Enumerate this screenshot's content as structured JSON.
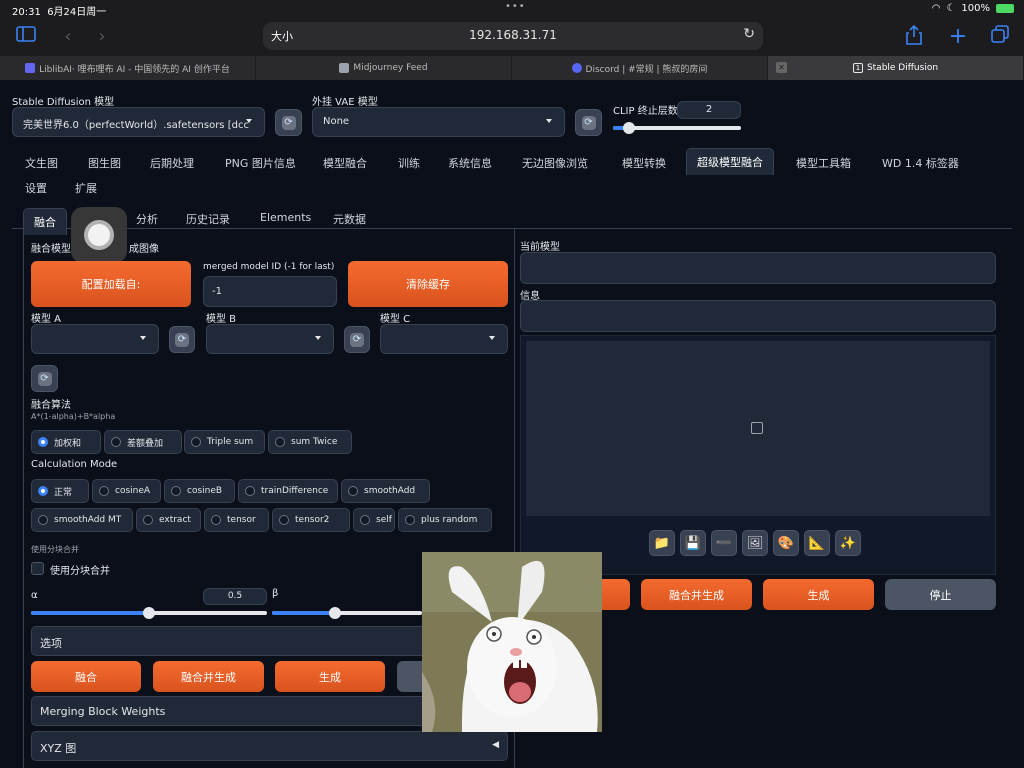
{
  "status": {
    "time": "20:31",
    "date": "6月24日周一",
    "battery": "100%"
  },
  "browser": {
    "text_size": "大小",
    "url": "192.168.31.71",
    "tabs": [
      {
        "label": "LiblibAI· 哩布哩布 AI - 中国领先的 AI 创作平台",
        "icon_color": "#6366f1"
      },
      {
        "label": "Midjourney Feed",
        "icon_color": "#9ca3af"
      },
      {
        "label": "Discord | #常规 | 熊叔的房间",
        "icon_color": "#5865f2"
      },
      {
        "label": "Stable Diffusion",
        "icon_color": "#e5e7eb"
      }
    ]
  },
  "top": {
    "sd_model_label": "Stable Diffusion 模型",
    "sd_model_value": "完美世界6.0（perfectWorld）.safetensors [dcc",
    "vae_label": "外挂 VAE 模型",
    "vae_value": "None",
    "clip_label": "CLIP 终止层数",
    "clip_value": "2",
    "clip_fraction": 0.0833
  },
  "main_tabs": [
    "文生图",
    "图生图",
    "后期处理",
    "PNG 图片信息",
    "模型融合",
    "训练",
    "系统信息",
    "无边图像浏览",
    "模型转换",
    "超级模型融合",
    "模型工具箱",
    "WD 1.4 标签器",
    "设置",
    "扩展"
  ],
  "sub_tabs": [
    "融合",
    "分析",
    "历史记录",
    "Elements",
    "元数据"
  ],
  "merge": {
    "section_label_left": "融合模型",
    "section_label_right": "成图像",
    "load_config_button": "配置加载自:",
    "model_id_label": "merged model ID (-1 for last)",
    "model_id_value": "-1",
    "clear_cache_button": "清除缓存",
    "model_a_label": "模型 A",
    "model_b_label": "模型 B",
    "model_c_label": "模型 C",
    "algorithm_label": "融合算法",
    "algorithm_formula": "A*(1-alpha)+B*alpha",
    "algorithms": [
      "加权和",
      "差额叠加",
      "Triple sum",
      "sum Twice"
    ],
    "calc_mode_label": "Calculation Mode",
    "calc_modes_row1": [
      "正常",
      "cosineA",
      "cosineB",
      "trainDifference",
      "smoothAdd"
    ],
    "calc_modes_row2": [
      "smoothAdd MT",
      "extract",
      "tensor",
      "tensor2",
      "self",
      "plus random"
    ],
    "block_merge_label": "使用分块合并",
    "block_merge_checkbox": "使用分块合并",
    "alpha_label": "α",
    "alpha_value": "0.5",
    "alpha_fraction": 0.5,
    "beta_label": "β",
    "beta_fraction": 0.42,
    "options_label": "选项",
    "bottom_buttons": [
      "融合",
      "融合并生成",
      "生成"
    ],
    "mbw_label": "Merging Block Weights",
    "xyz_label": "XYZ 图"
  },
  "right": {
    "current_model_label": "当前模型",
    "info_label": "信息",
    "image_placeholder_icon": "image-icon",
    "tools": [
      "folder-icon",
      "save-icon",
      "send-icon",
      "image-send-icon",
      "palette-icon",
      "ruler-icon",
      "sparkle-icon"
    ],
    "buttons": [
      "融合并生成",
      "生成",
      "停止"
    ]
  }
}
